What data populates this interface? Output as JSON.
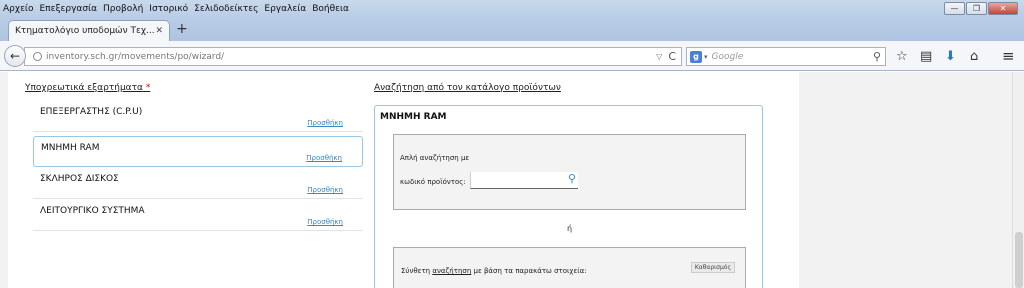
{
  "menu": [
    "Αρχείο",
    "Επεξεργασία",
    "Προβολή",
    "Ιστορικό",
    "Σελιδοδείκτες",
    "Εργαλεία",
    "Βοήθεια"
  ],
  "window_buttons": {
    "minimize": "—",
    "maximize": "❐",
    "close": "✕"
  },
  "tab": {
    "title": "Κτηματολόγιο υποδομών Τεχ...",
    "close": "✕",
    "new": "+"
  },
  "nav": {
    "back": "←",
    "url": "inventory.sch.gr/movements/po/wizard/",
    "url_drop": "▽",
    "reload": "C",
    "search_engine_letter": "g",
    "search_drop": "▾",
    "search_placeholder": "Google",
    "search_icon": "⚲",
    "star": "☆",
    "clipboard": "▤",
    "download": "⬇",
    "home": "⌂",
    "menu": "≡"
  },
  "left": {
    "header": "Υποχρεωτικά εξαρτήματα",
    "required_mark": "*",
    "items": [
      {
        "name": "ΕΠΕΞΕΡΓΑΣΤΗΣ (C.P.U)",
        "action": "Προσθήκη"
      },
      {
        "name": "ΜΝΗΜΗ RAM",
        "action": "Προσθήκη"
      },
      {
        "name": "ΣΚΛΗΡΟΣ ΔΙΣΚΟΣ",
        "action": "Προσθήκη"
      },
      {
        "name": "ΛΕΙΤΟΥΡΓΙΚΟ ΣΥΣΤΗΜΑ",
        "action": "Προσθήκη"
      }
    ]
  },
  "right": {
    "header": "Αναζήτηση από τον κατάλογο προϊόντων",
    "panel_title": "ΜΝΗΜΗ RAM",
    "simple_search_line1": "Απλή αναζήτηση με",
    "simple_search_line2": "κωδικό προϊόντος:",
    "product_code_value": "",
    "search_icon": "⚲",
    "or": "ή",
    "composite_prefix": "Σύνθετη",
    "composite_link": "αναζήτηση",
    "composite_suffix": "με βάση τα παρακάτω στοιχεία:",
    "clear": "Καθαρισμός"
  }
}
